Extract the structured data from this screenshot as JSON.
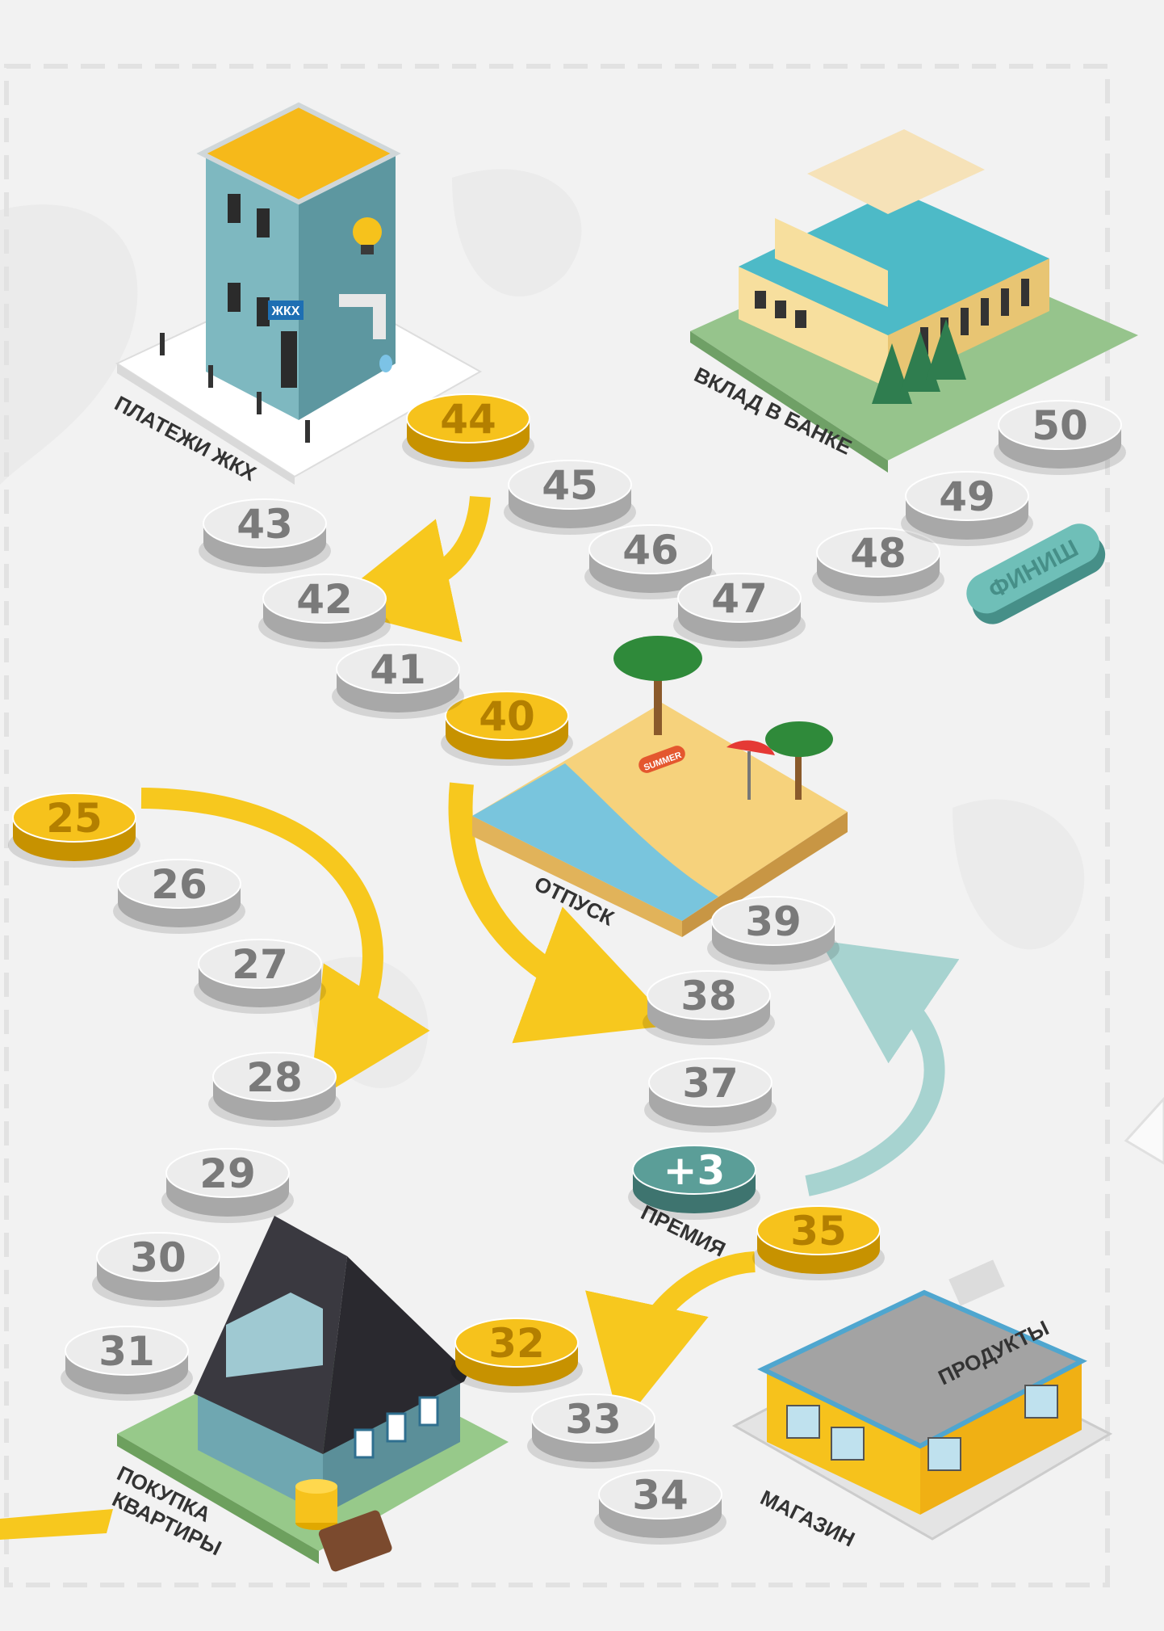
{
  "board": {
    "colors": {
      "background": "#f2f2f2",
      "coin_silver": "#e9e9e9",
      "coin_gold": "#f6c21c",
      "coin_teal": "#5b9e98",
      "arrow_yellow": "#f7c81e",
      "arrow_teal": "#a7d3d0"
    },
    "cells": [
      {
        "label": "25",
        "kind": "gold"
      },
      {
        "label": "26",
        "kind": "silver"
      },
      {
        "label": "27",
        "kind": "silver"
      },
      {
        "label": "28",
        "kind": "silver"
      },
      {
        "label": "29",
        "kind": "silver"
      },
      {
        "label": "30",
        "kind": "silver"
      },
      {
        "label": "31",
        "kind": "silver"
      },
      {
        "label": "32",
        "kind": "gold"
      },
      {
        "label": "33",
        "kind": "silver"
      },
      {
        "label": "34",
        "kind": "silver"
      },
      {
        "label": "35",
        "kind": "gold"
      },
      {
        "label": "+3",
        "kind": "teal"
      },
      {
        "label": "37",
        "kind": "silver"
      },
      {
        "label": "38",
        "kind": "silver"
      },
      {
        "label": "39",
        "kind": "silver"
      },
      {
        "label": "40",
        "kind": "gold"
      },
      {
        "label": "41",
        "kind": "silver"
      },
      {
        "label": "42",
        "kind": "silver"
      },
      {
        "label": "43",
        "kind": "silver"
      },
      {
        "label": "44",
        "kind": "gold"
      },
      {
        "label": "45",
        "kind": "silver"
      },
      {
        "label": "46",
        "kind": "silver"
      },
      {
        "label": "47",
        "kind": "silver"
      },
      {
        "label": "48",
        "kind": "silver"
      },
      {
        "label": "49",
        "kind": "silver"
      },
      {
        "label": "50",
        "kind": "silver"
      }
    ],
    "places": {
      "utilities": {
        "label": "ПЛАТЕЖИ ЖКХ",
        "sign": "ЖКХ"
      },
      "bank": {
        "label": "ВКЛАД В БАНКЕ"
      },
      "vacation": {
        "label": "ОТПУСК",
        "board_text": "SUMMER"
      },
      "bonus": {
        "label": "ПРЕМИЯ"
      },
      "shop": {
        "label": "МАГАЗИН",
        "sign": "ПРОДУКТЫ"
      },
      "apartment": {
        "label_line1": "ПОКУПКА",
        "label_line2": "КВАРТИРЫ"
      }
    },
    "finish": {
      "label": "ФИНИШ"
    }
  }
}
